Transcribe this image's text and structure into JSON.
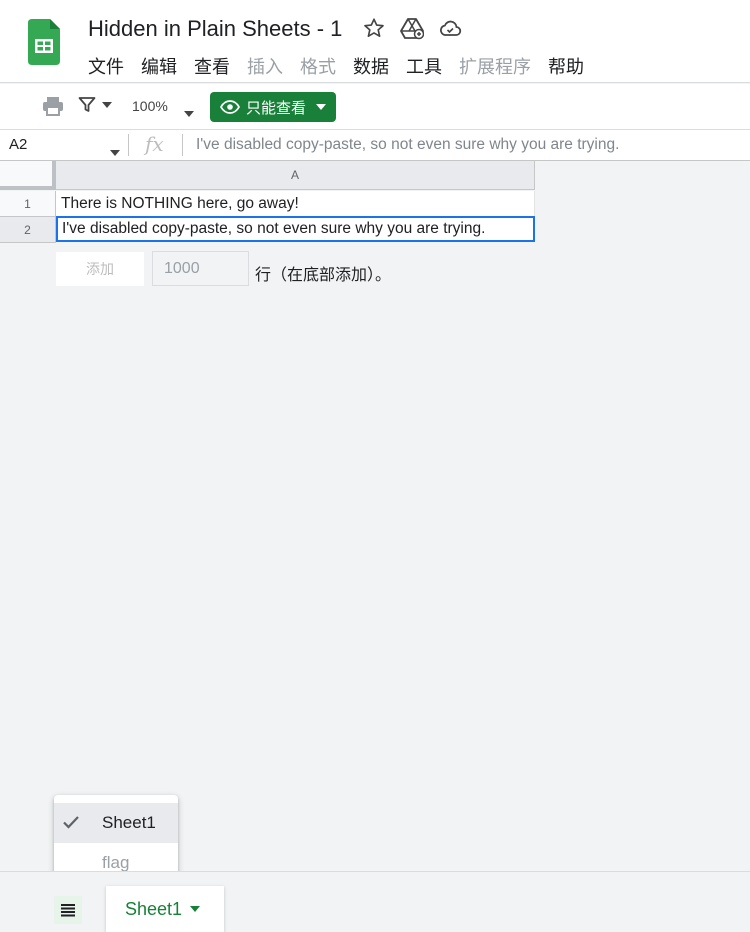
{
  "header": {
    "title": "Hidden in Plain Sheets - 1",
    "icons": [
      "star-icon",
      "move-to-drive-icon",
      "cloud-status-icon"
    ],
    "menu": [
      {
        "label": "文件",
        "enabled": true
      },
      {
        "label": "编辑",
        "enabled": true
      },
      {
        "label": "查看",
        "enabled": true
      },
      {
        "label": "插入",
        "enabled": false
      },
      {
        "label": "格式",
        "enabled": false
      },
      {
        "label": "数据",
        "enabled": true
      },
      {
        "label": "工具",
        "enabled": true
      },
      {
        "label": "扩展程序",
        "enabled": false
      },
      {
        "label": "帮助",
        "enabled": true
      }
    ]
  },
  "toolbar": {
    "zoom": "100%",
    "view_only_label": "只能查看",
    "accent": "#188038"
  },
  "formula_bar": {
    "cell_ref": "A2",
    "fx": "fx",
    "content": "I've disabled copy-paste, so not even sure why you are trying."
  },
  "grid": {
    "column_headers": [
      "A"
    ],
    "rows": [
      {
        "number": "1",
        "cells": [
          "There is NOTHING here, go away!"
        ]
      },
      {
        "number": "2",
        "cells": [
          "I've disabled copy-paste, so not even sure why you are trying."
        ]
      }
    ],
    "selected_cell": "A2"
  },
  "add_rows": {
    "button_label": "添加",
    "value": "1000",
    "suffix": "行（在底部添加）。"
  },
  "sheet_menu": {
    "items": [
      {
        "label": "Sheet1",
        "checked": true
      },
      {
        "label": "flag",
        "checked": false
      }
    ]
  },
  "bottom_bar": {
    "active_tab": "Sheet1"
  }
}
